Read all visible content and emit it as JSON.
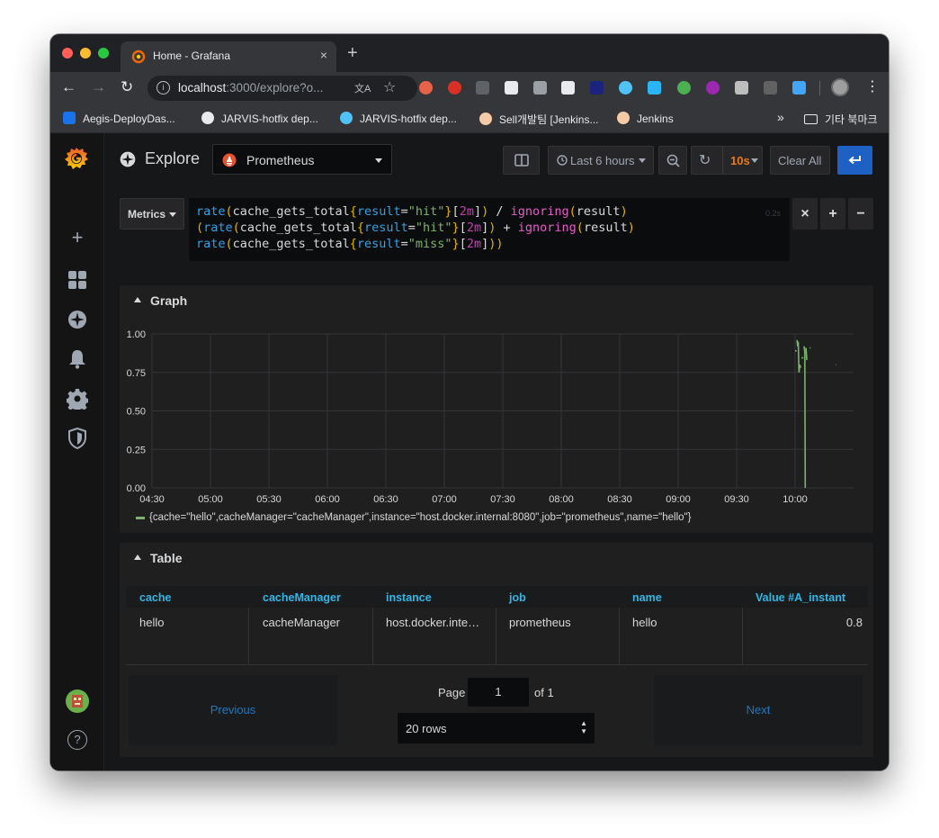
{
  "browser": {
    "tab_title": "Home - Grafana",
    "tab_close": "×",
    "new_tab": "+",
    "url_host": "localhost",
    "url_rest": ":3000/explore?o...",
    "bookmarks": [
      {
        "label": "Aegis-DeployDas...",
        "icon_color": "#1a73e8"
      },
      {
        "label": "JARVIS-hotfix dep...",
        "icon_color": "#e8eaed"
      },
      {
        "label": "JARVIS-hotfix dep...",
        "icon_color": "#4fc3f7"
      },
      {
        "label": "Sell개발팀 [Jenkins...",
        "icon_color": "#f5cba7"
      },
      {
        "label": "Jenkins",
        "icon_color": "#f5cba7"
      }
    ],
    "bookmarks_more": "»",
    "other_bookmarks": "기타 북마크"
  },
  "explore": {
    "title": "Explore",
    "datasource": "Prometheus",
    "time_range": "Last 6 hours",
    "refresh": "10s",
    "clear_all": "Clear All",
    "metrics_label": "Metrics",
    "query_time": "0.2s"
  },
  "query": {
    "line1": "rate(cache_gets_total{result=\"hit\"}[2m]) / ignoring(result)",
    "line2": "(rate(cache_gets_total{result=\"hit\"}[2m]) + ignoring(result)",
    "line3": "rate(cache_gets_total{result=\"miss\"}[2m]))"
  },
  "graph": {
    "title": "Graph",
    "legend": "{cache=\"hello\",cacheManager=\"cacheManager\",instance=\"host.docker.internal:8080\",job=\"prometheus\",name=\"hello\"}"
  },
  "chart_data": {
    "type": "line",
    "xlabel": "",
    "ylabel": "",
    "x_ticks": [
      "04:30",
      "05:00",
      "05:30",
      "06:00",
      "06:30",
      "07:00",
      "07:30",
      "08:00",
      "08:30",
      "09:00",
      "09:30",
      "10:00"
    ],
    "y_ticks": [
      "0.00",
      "0.25",
      "0.50",
      "0.75",
      "1.00"
    ],
    "ylim": [
      0,
      1
    ],
    "xlim_minutes": [
      270,
      630
    ],
    "grid": true,
    "legend_position": "bottom",
    "series": [
      {
        "name": "{cache=\"hello\",cacheManager=\"cacheManager\",instance=\"host.docker.internal:8080\",job=\"prometheus\",name=\"hello\"}",
        "color": "#7eb26d",
        "segments": [
          [
            [
              600.0,
              0.89
            ],
            [
              600.8,
              0.89
            ]
          ],
          [
            [
              601.0,
              0.96
            ],
            [
              601.3,
              0.92
            ],
            [
              601.6,
              0.95
            ],
            [
              602.0,
              0.75
            ],
            [
              602.4,
              0.8
            ],
            [
              602.8,
              0.78
            ]
          ],
          [
            [
              603.5,
              0.84
            ],
            [
              604.0,
              0.85
            ]
          ],
          [
            [
              604.6,
              0.92
            ],
            [
              605.0,
              0.88
            ],
            [
              605.2,
              0.0
            ]
          ],
          [
            [
              605.6,
              0.91
            ],
            [
              606.0,
              0.83
            ]
          ],
          [
            [
              607.5,
              0.91
            ],
            [
              608.0,
              0.91
            ]
          ],
          [
            [
              621.0,
              0.8
            ],
            [
              621.2,
              0.8
            ]
          ]
        ]
      }
    ]
  },
  "table": {
    "title": "Table",
    "headers": [
      "cache",
      "cacheManager",
      "instance",
      "job",
      "name",
      "Value #A_instant"
    ],
    "rows": [
      [
        "hello",
        "cacheManager",
        "host.docker.interna...",
        "prometheus",
        "hello",
        "0.8"
      ]
    ],
    "previous": "Previous",
    "next": "Next",
    "page_label": "Page",
    "page_value": "1",
    "page_total": "of 1",
    "rows_option": "20 rows"
  },
  "colors": {
    "accent_blue": "#1f60c4",
    "refresh_orange": "#eb7b18",
    "series_green": "#7eb26d",
    "header_blue": "#33b5e5"
  }
}
